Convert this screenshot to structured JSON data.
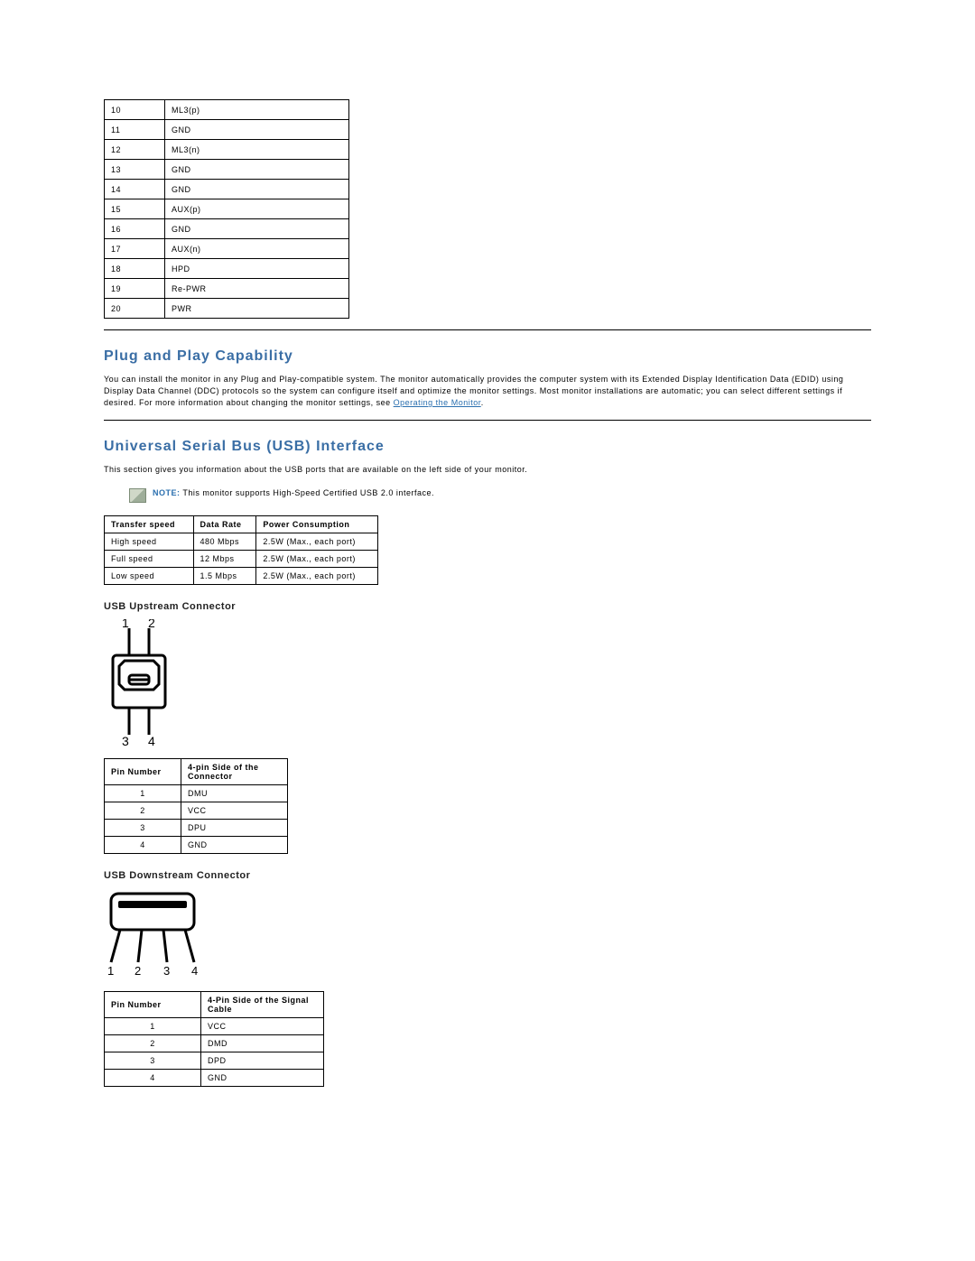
{
  "pin_table": {
    "rows": [
      {
        "num": "10",
        "name": "ML3(p)"
      },
      {
        "num": "11",
        "name": "GND"
      },
      {
        "num": "12",
        "name": "ML3(n)"
      },
      {
        "num": "13",
        "name": "GND"
      },
      {
        "num": "14",
        "name": "GND"
      },
      {
        "num": "15",
        "name": "AUX(p)"
      },
      {
        "num": "16",
        "name": "GND"
      },
      {
        "num": "17",
        "name": "AUX(n)"
      },
      {
        "num": "18",
        "name": "HPD"
      },
      {
        "num": "19",
        "name": "Re-PWR"
      },
      {
        "num": "20",
        "name": "PWR"
      }
    ]
  },
  "plug_play": {
    "heading": "Plug and Play Capability",
    "body": "You can install the monitor in any Plug and Play-compatible system. The monitor automatically provides the computer system with its Extended Display Identification Data (EDID) using Display Data Channel (DDC) protocols so the system can configure itself and optimize the monitor settings. Most monitor installations are automatic; you can select different settings if desired. For more information about changing the monitor settings, see ",
    "link": "Operating the Monitor",
    "period": "."
  },
  "usb": {
    "heading": "Universal Serial Bus (USB) Interface",
    "intro": "This section gives you information about the USB ports that are available on the left side of your monitor.",
    "note_label": "NOTE:",
    "note_body": " This monitor supports High-Speed Certified USB 2.0 interface.",
    "speed_table": {
      "head": {
        "a": "Transfer speed",
        "b": "Data Rate",
        "c": "Power Consumption"
      },
      "rows": [
        {
          "a": "High speed",
          "b": "480 Mbps",
          "c": "2.5W (Max., each port)"
        },
        {
          "a": "Full speed",
          "b": "12 Mbps",
          "c": "2.5W (Max., each port)"
        },
        {
          "a": "Low speed",
          "b": "1.5 Mbps",
          "c": "2.5W (Max., each port)"
        }
      ]
    },
    "upstream": {
      "heading": "USB Upstream Connector",
      "head": {
        "a": "Pin Number",
        "b": "4-pin Side of the Connector"
      },
      "rows": [
        {
          "a": "1",
          "b": "DMU"
        },
        {
          "a": "2",
          "b": "VCC"
        },
        {
          "a": "3",
          "b": "DPU"
        },
        {
          "a": "4",
          "b": "GND"
        }
      ]
    },
    "downstream": {
      "heading": "USB Downstream Connector",
      "head": {
        "a": "Pin Number",
        "b": "4-Pin Side of the Signal Cable"
      },
      "rows": [
        {
          "a": "1",
          "b": "VCC"
        },
        {
          "a": "2",
          "b": "DMD"
        },
        {
          "a": "3",
          "b": "DPD"
        },
        {
          "a": "4",
          "b": "GND"
        }
      ]
    }
  }
}
